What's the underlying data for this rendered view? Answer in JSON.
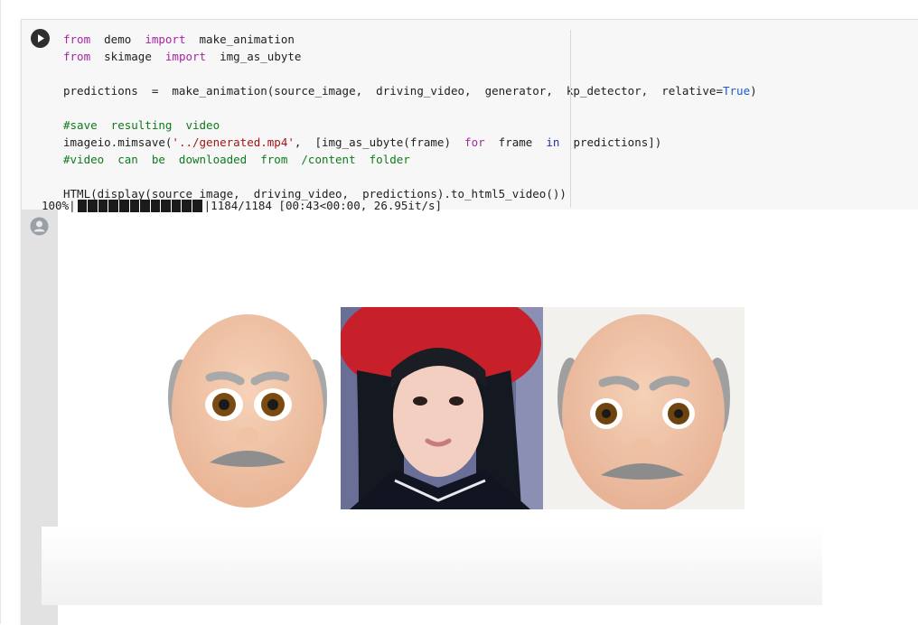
{
  "cell": {
    "run_button_icon": "play-icon",
    "output_icon": "user-avatar-icon",
    "code_lines": [
      [
        {
          "t": "from",
          "c": "kw"
        },
        {
          "t": "  demo  ",
          "c": ""
        },
        {
          "t": "import",
          "c": "kw"
        },
        {
          "t": "  make_animation",
          "c": ""
        }
      ],
      [
        {
          "t": "from",
          "c": "kw"
        },
        {
          "t": "  skimage  ",
          "c": ""
        },
        {
          "t": "import",
          "c": "kw"
        },
        {
          "t": "  img_as_ubyte",
          "c": ""
        }
      ],
      [],
      [
        {
          "t": "predictions  =  make_animation(source_image,  driving_video,  generator,  kp_detector,  relative=",
          "c": ""
        },
        {
          "t": "True",
          "c": "const"
        },
        {
          "t": ")",
          "c": ""
        }
      ],
      [],
      [
        {
          "t": "#save  resulting  video",
          "c": "cmt"
        }
      ],
      [
        {
          "t": "imageio.mimsave(",
          "c": ""
        },
        {
          "t": "'../generated.mp4'",
          "c": "str"
        },
        {
          "t": ",  [img_as_ubyte(frame)  ",
          "c": ""
        },
        {
          "t": "for",
          "c": "kw"
        },
        {
          "t": "  frame  ",
          "c": ""
        },
        {
          "t": "in",
          "c": "kw-blue"
        },
        {
          "t": "  predictions])",
          "c": ""
        }
      ],
      [
        {
          "t": "#video  can  be  downloaded  from  /content  folder",
          "c": "cmt"
        }
      ],
      [],
      [
        {
          "t": "HTML(display(source_image,  driving_video,  predictions).to_html5_video())",
          "c": ""
        }
      ]
    ]
  },
  "output": {
    "progress_percent_text": "100%",
    "progress_fraction": 1.0,
    "progress_segments": 12,
    "progress_stats": "1184/1184 [00:43<00:00, 26.95it/s]",
    "panels": [
      {
        "name": "source-image-frame"
      },
      {
        "name": "driving-video-frame"
      },
      {
        "name": "generated-frame"
      }
    ]
  },
  "colors": {
    "keyword": "#a626a4",
    "keyword_blue": "#2532a6",
    "constant": "#1a5bd0",
    "string": "#a31515",
    "comment": "#0f7a1d",
    "code_bg": "#f7f7f7",
    "gutter_bg": "#e2e2e2"
  }
}
